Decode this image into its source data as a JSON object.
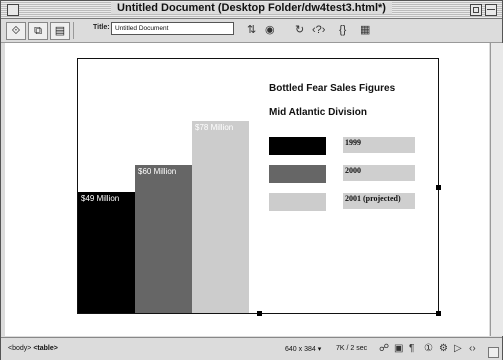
{
  "window": {
    "title": "Untitled Document (Desktop Folder/dw4test3.html*)"
  },
  "toolbar": {
    "title_label": "Title:",
    "title_value": "Untitled Document"
  },
  "chart_data": {
    "type": "bar",
    "title": "Bottled Fear Sales Figures",
    "subtitle": "Mid Atlantic Division",
    "categories": [
      "1999",
      "2000",
      "2001 (projected)"
    ],
    "values": [
      49,
      60,
      78
    ],
    "value_labels": [
      "$49 Million",
      "$60 Million",
      "$78 Million"
    ],
    "colors": [
      "#000000",
      "#666666",
      "#cccccc"
    ],
    "ylim": [
      0,
      100
    ]
  },
  "status": {
    "tag_body": "<body>",
    "tag_table": "<table>",
    "size": "640 x 384",
    "download": "7K / 2 sec"
  }
}
